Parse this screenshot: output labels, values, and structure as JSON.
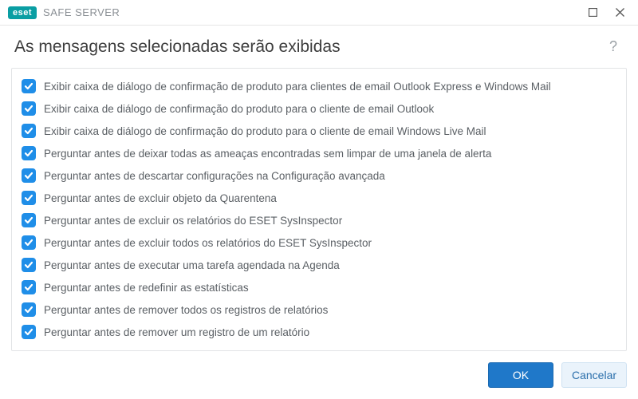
{
  "brand": {
    "badge": "eset",
    "product": "SAFE SERVER"
  },
  "header": {
    "title": "As mensagens selecionadas serão exibidas",
    "help": "?"
  },
  "options": [
    {
      "checked": true,
      "label": "Exibir caixa de diálogo de confirmação de produto para clientes de email Outlook Express e Windows Mail"
    },
    {
      "checked": true,
      "label": "Exibir caixa de diálogo de confirmação do produto para o cliente de email Outlook"
    },
    {
      "checked": true,
      "label": "Exibir caixa de diálogo de confirmação do produto para o cliente de email Windows Live Mail"
    },
    {
      "checked": true,
      "label": "Perguntar antes de deixar todas as ameaças encontradas sem limpar de uma janela de alerta"
    },
    {
      "checked": true,
      "label": "Perguntar antes de descartar configurações na Configuração avançada"
    },
    {
      "checked": true,
      "label": "Perguntar antes de excluir objeto da Quarentena"
    },
    {
      "checked": true,
      "label": "Perguntar antes de excluir os relatórios do ESET SysInspector"
    },
    {
      "checked": true,
      "label": "Perguntar antes de excluir todos os relatórios do ESET SysInspector"
    },
    {
      "checked": true,
      "label": "Perguntar antes de executar uma tarefa agendada na Agenda"
    },
    {
      "checked": true,
      "label": "Perguntar antes de redefinir as estatísticas"
    },
    {
      "checked": true,
      "label": "Perguntar antes de remover todos os registros de relatórios"
    },
    {
      "checked": true,
      "label": "Perguntar antes de remover um registro de um relatório"
    }
  ],
  "footer": {
    "ok": "OK",
    "cancel": "Cancelar"
  }
}
